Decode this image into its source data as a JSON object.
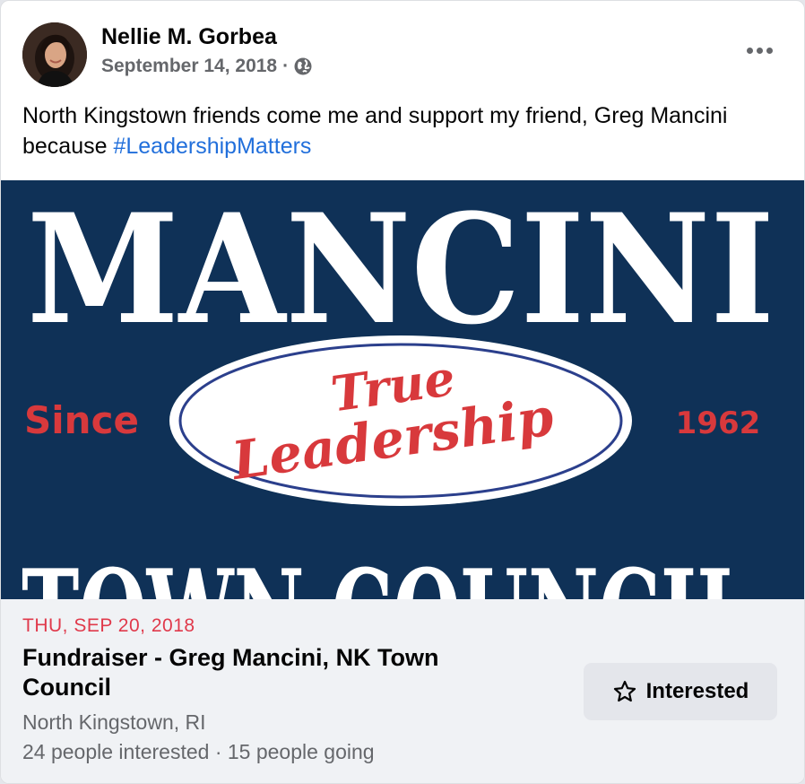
{
  "post": {
    "author": "Nellie M. Gorbea",
    "date": "September 14, 2018",
    "separator": "·",
    "privacy_icon": "globe-icon",
    "text_before": "North Kingstown friends come me and support my friend, Greg Mancini because ",
    "hashtag": "#LeadershipMatters"
  },
  "banner": {
    "top_word": "MANCINI",
    "script_line1": "True",
    "script_line2": "Leadership",
    "left_text": "Since",
    "right_text": "1962",
    "bottom_text": "TOWN COUNCIL",
    "colors": {
      "navy": "#0f3157",
      "red": "#d8393c",
      "white": "#ffffff",
      "oval_border": "#2b3f8c"
    }
  },
  "event": {
    "date": "THU, SEP 20, 2018",
    "title": "Fundraiser - Greg Mancini, NK Town Council",
    "location": "North Kingstown, RI",
    "stats": "24 people interested · 15 people going",
    "button_label": "Interested",
    "button_icon": "star-icon"
  },
  "colors": {
    "link": "#216fdb",
    "date_red": "#e0394b",
    "muted": "#65676b"
  }
}
